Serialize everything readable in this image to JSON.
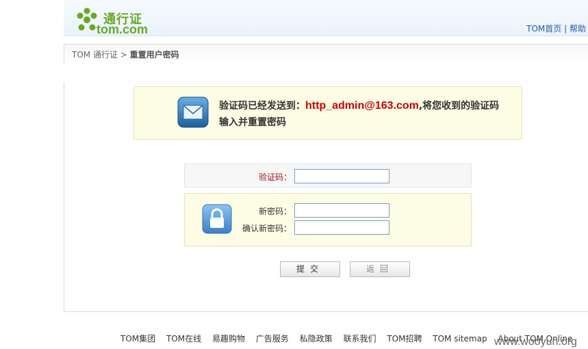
{
  "header": {
    "logo_title": "通行证",
    "logo_domain": "tom.com",
    "links": [
      "TOM首页",
      "帮助"
    ],
    "separator": "|"
  },
  "breadcrumb": {
    "root": "TOM 通行证",
    "sep": " > ",
    "current": "重置用户密码"
  },
  "notice": {
    "prefix": "验证码已经发送到：",
    "email": "http_admin@163.com",
    "suffix": ",将您收到的验证码输入并重置密码"
  },
  "form": {
    "code_label": "验证码：",
    "code_value": "",
    "new_password_label": "新密码：",
    "new_password_value": "",
    "confirm_password_label": "确认新密码：",
    "confirm_password_value": ""
  },
  "buttons": {
    "submit": "提交",
    "back": "返回"
  },
  "footer": {
    "links": [
      "TOM集团",
      "TOM在线",
      "易趣购物",
      "广告服务",
      "私隐政策",
      "联系我们",
      "TOM招聘",
      "TOM sitemap",
      "About TOM Online"
    ]
  },
  "watermark": "www.wooyun.org",
  "colors": {
    "brand_green": "#67a825",
    "link_blue": "#1a5eab",
    "email_red": "#cc0000",
    "panel_yellow": "#fdfde5"
  }
}
